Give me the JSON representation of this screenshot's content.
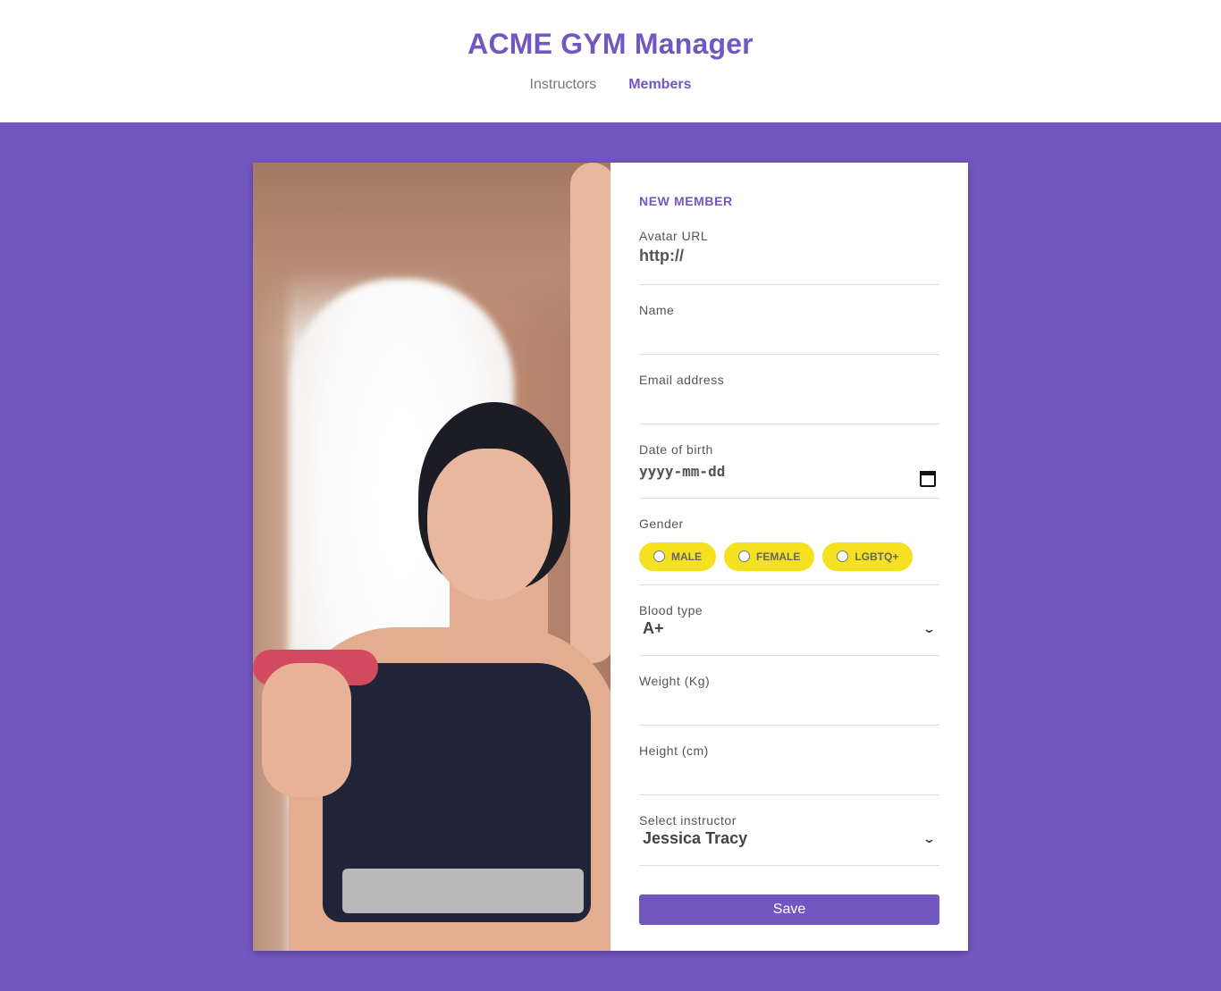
{
  "header": {
    "title": "ACME GYM Manager",
    "nav": [
      {
        "label": "Instructors",
        "active": false
      },
      {
        "label": "Members",
        "active": true
      }
    ]
  },
  "form": {
    "title": "NEW MEMBER",
    "avatar": {
      "label": "Avatar URL",
      "value": "http://"
    },
    "name": {
      "label": "Name",
      "value": ""
    },
    "email": {
      "label": "Email address",
      "value": ""
    },
    "dob": {
      "label": "Date of birth",
      "value": "yyyy-mm-dd"
    },
    "gender": {
      "label": "Gender",
      "options": [
        "MALE",
        "FEMALE",
        "LGBTQ+"
      ]
    },
    "blood": {
      "label": "Blood type",
      "value": "A+"
    },
    "weight": {
      "label": "Weight (Kg)",
      "value": ""
    },
    "height": {
      "label": "Height (cm)",
      "value": ""
    },
    "instructor": {
      "label": "Select instructor",
      "value": "Jessica Tracy"
    },
    "save_label": "Save"
  },
  "colors": {
    "accent": "#7357c0",
    "chip": "#f5e11f"
  }
}
